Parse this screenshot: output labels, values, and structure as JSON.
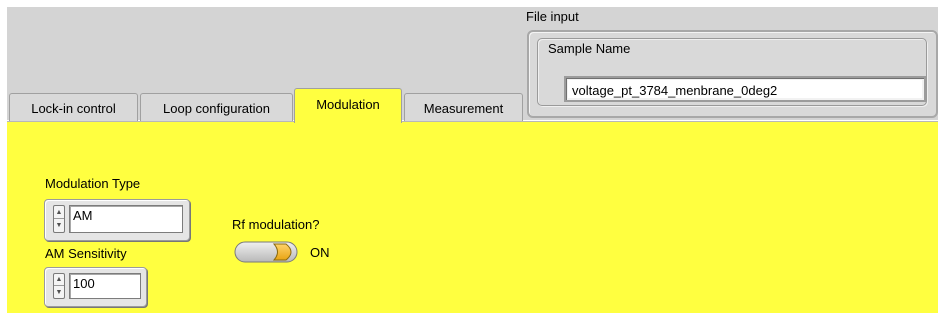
{
  "file_input": {
    "label": "File input",
    "sample_name_label": "Sample Name",
    "sample_name_value": "voltage_pt_3784_menbrane_0deg2"
  },
  "tabs": [
    {
      "label": "Lock-in control",
      "active": false
    },
    {
      "label": "Loop configuration",
      "active": false
    },
    {
      "label": "Modulation",
      "active": true
    },
    {
      "label": "Measurement",
      "active": false
    }
  ],
  "modulation": {
    "type_label": "Modulation Type",
    "type_value": "AM",
    "am_sensitivity_label": "AM Sensitivity",
    "am_sensitivity_value": "100",
    "rf_label": "Rf modulation?",
    "rf_state": "ON"
  },
  "colors": {
    "panel_bg": "#ffff40",
    "toggle_on": "#f5b422"
  },
  "icons": {
    "spin_up": "▲",
    "spin_down": "▼"
  }
}
